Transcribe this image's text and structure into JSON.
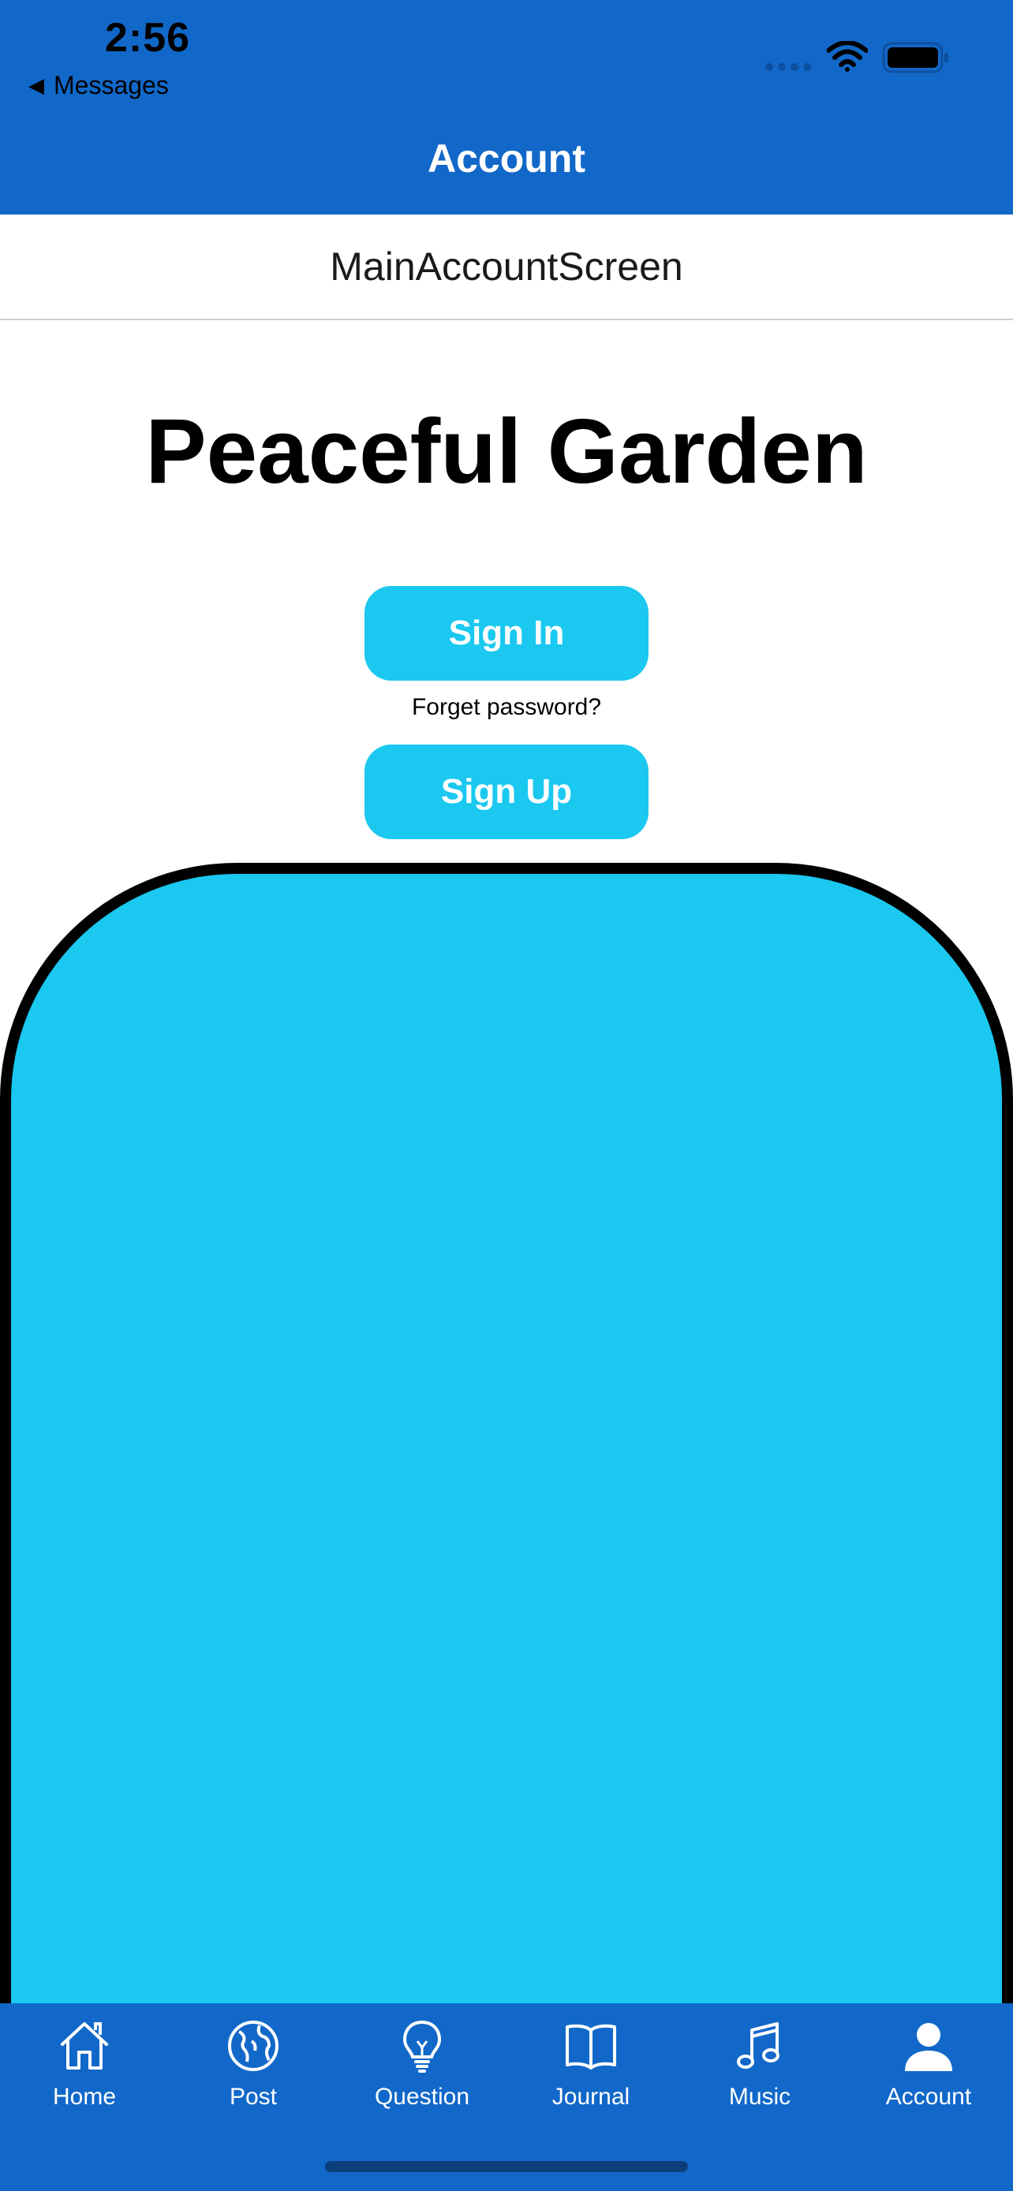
{
  "status_bar": {
    "time": "2:56",
    "back_label": "Messages"
  },
  "nav": {
    "title": "Account",
    "screen_name": "MainAccountScreen"
  },
  "main": {
    "app_title": "Peaceful Garden",
    "sign_in_label": "Sign In",
    "forgot_label": "Forget password?",
    "sign_up_label": "Sign Up"
  },
  "tabs": [
    {
      "label": "Home",
      "icon": "home-icon"
    },
    {
      "label": "Post",
      "icon": "globe-icon"
    },
    {
      "label": "Question",
      "icon": "lightbulb-icon"
    },
    {
      "label": "Journal",
      "icon": "book-icon"
    },
    {
      "label": "Music",
      "icon": "music-note-icon"
    },
    {
      "label": "Account",
      "icon": "person-icon",
      "active": true
    }
  ],
  "colors": {
    "header_blue": "#1268c9",
    "accent_cyan": "#1ac8f0",
    "panel_border": "#000000"
  }
}
